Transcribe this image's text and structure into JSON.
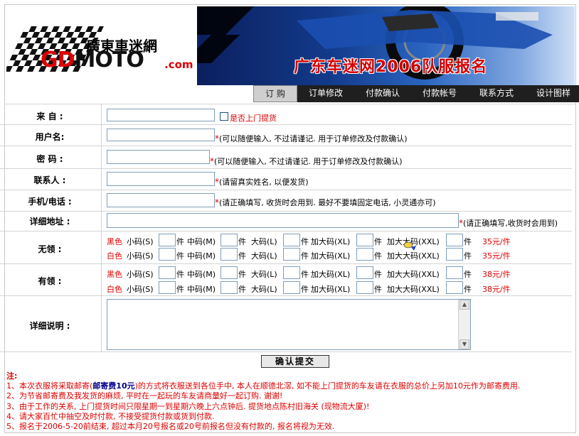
{
  "banner": {
    "logo_text": "廣東車迷網",
    "logo_moto_gd": "GD",
    "logo_moto": "MOTO",
    "logo_com": ".com",
    "title": "广东车迷网2006队服报名"
  },
  "tabs": [
    {
      "label": "订 购",
      "active": true
    },
    {
      "label": "订单修改",
      "active": false
    },
    {
      "label": "付款确认",
      "active": false
    },
    {
      "label": "付款帐号",
      "active": false
    },
    {
      "label": "联系方式",
      "active": false
    },
    {
      "label": "设计图样",
      "active": false
    }
  ],
  "form": {
    "from_label": "来 自 :",
    "pickup_label": "是否上门提货",
    "username_label": "用户名:",
    "username_hint": "(可以随便输入, 不过请谨记. 用于订单修改及付款确认)",
    "password_label": "密 码 :",
    "password_hint": "(可以随便输入, 不过请谨记. 用于订单修改及付款确认)",
    "contact_label": "联系人 :",
    "contact_hint": "(请留真实姓名, 以便发货)",
    "phone_label": "手机/电话 :",
    "phone_hint": "(请正确填写, 收货时会用到. 最好不要填固定电话, 小灵通亦可)",
    "address_label": "详细地址 :",
    "address_hint": "(请正确填写,收货时会用到)",
    "star": "*",
    "collarless_label": "无领 :",
    "collared_label": "有领 :",
    "notes_label": "详细说明 :",
    "submit": "确认提交"
  },
  "sizes": {
    "black": "黑色",
    "white": "白色",
    "s": "小码(S)",
    "m": "中码(M)",
    "l": "大码(L)",
    "xl": "加大码(XL)",
    "xxl": "加大大码(XXL)",
    "unit": "件",
    "price_collarless": "35元/件",
    "price_collared": "38元/件"
  },
  "notes": {
    "title": "注:",
    "line1_a": "1、本次衣服将采取邮寄(",
    "line1_b": "邮寄费10元",
    "line1_c": ")的方式将衣服送到各位手中, 本人在顺德北滘, 如不能上门提货的车友请在衣服的总价上另加10元作为邮寄费用.",
    "line2": "2、为节省邮寄费及我发货的麻烦, 平时在一起玩的车友请商量好一起订购. 谢谢!",
    "line3": "3、由于工作的关系, 上门提货时间只限星期一到星期六晚上六点钟后. 提货地点陈村旧海关 (现物流大厦)!",
    "line4": "4、请大家百忙中抽空及时付款, 不接受提货付款或货到付款.",
    "line5": "5、报名于2006-5-20前结束, 超过本月20号报名或20号前报名但没有付款的, 报名将视为无效."
  },
  "colors": {
    "accent_red": "#d00000",
    "tab_bg": "#1f1f1f",
    "border": "#d4d4d4"
  }
}
